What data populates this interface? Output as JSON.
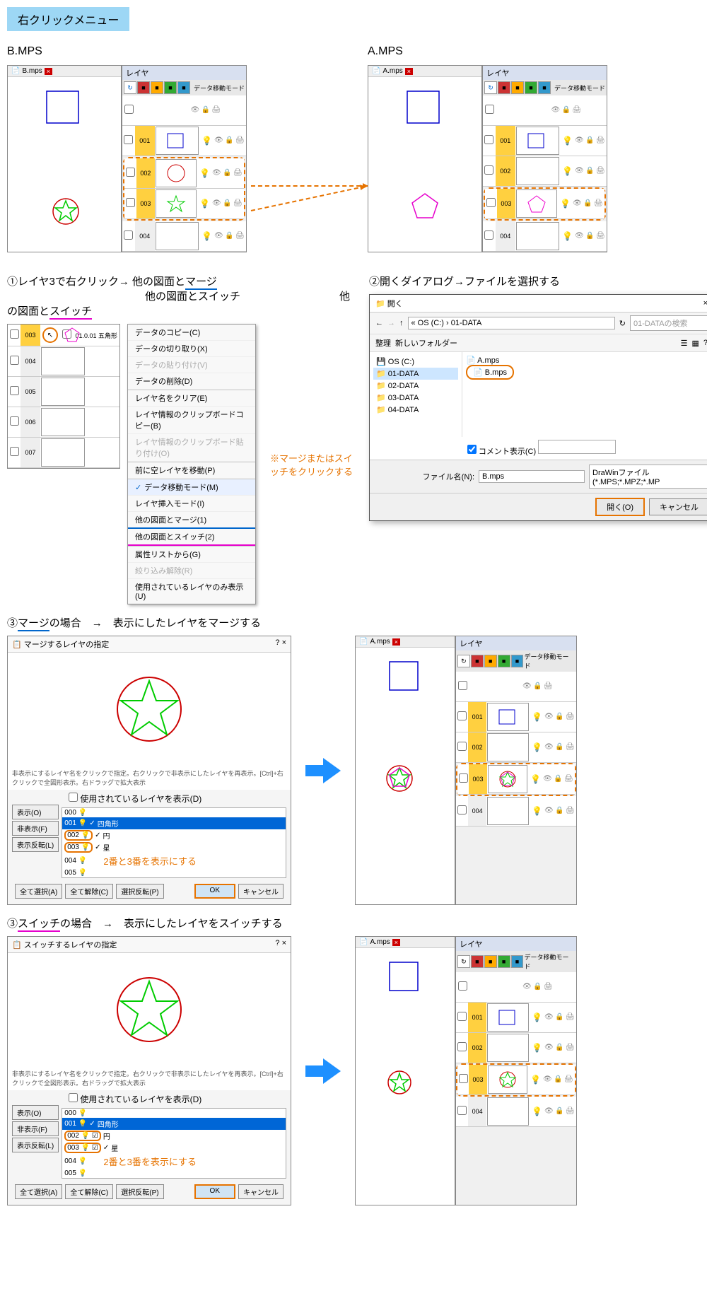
{
  "banner": "右クリックメニュー",
  "tabs": {
    "b": "B.mps",
    "a": "A.mps"
  },
  "labels": {
    "b": "B.MPS",
    "a": "A.MPS",
    "layer": "レイヤ",
    "mode": "データ移動モード"
  },
  "layers": [
    "001",
    "002",
    "003",
    "004",
    "005"
  ],
  "step1": {
    "text": "①レイヤ3で右クリック→ 他の図面と",
    "merge": "マージ",
    "switch": "他の図面とスイッチ",
    "sw": "スイッチ"
  },
  "step2": "②開くダイアログ→ファイルを選択する",
  "ctx": {
    "hdr": "01.0.01  五角形",
    "items": [
      "データのコピー(C)",
      "データの切り取り(X)",
      "データの貼り付け(V)",
      "データの削除(D)",
      "",
      "レイヤ名をクリア(E)",
      "レイヤ情報のクリップボードコピー(B)",
      "レイヤ情報のクリップボード貼り付け(O)",
      "",
      "前に空レイヤを移動(P)",
      "",
      "データ移動モード(M)",
      "レイヤ挿入モード(I)",
      "他の図面とマージ(1)",
      "他の図面とスイッチ(2)",
      "",
      "属性リストから(G)",
      "絞り込み解除(R)",
      "使用されているレイヤのみ表示(U)"
    ]
  },
  "ctxnote": "※マージまたはスイッチをクリックする",
  "open": {
    "title": "開く",
    "path": "« OS (C:) › 01-DATA",
    "search": "01-DATAの検索",
    "org": "整理",
    "newf": "新しいフォルダー",
    "tree": [
      "OS (C:)",
      "01-DATA",
      "02-DATA",
      "03-DATA",
      "04-DATA"
    ],
    "files": [
      "A.mps",
      "B.mps"
    ],
    "comment": "コメント表示(C)",
    "fname": "ファイル名(N):",
    "fval": "B.mps",
    "filter": "DraWinファイル(*.MPS;*.MPZ;*.MP",
    "ok": "開く(O)",
    "cancel": "キャンセル"
  },
  "step3m": "③マージの場合　→　表示にしたレイヤをマージする",
  "step3s": "③スイッチの場合　→　表示にしたレイヤをスイッチする",
  "mdlg": {
    "titlem": "マージするレイヤの指定",
    "titles": "スイッチするレイヤの指定",
    "help": "非表示にするレイヤ名をクリックで指定。右クリックで非表示にしたレイヤを再表示。[Ctrl]+右クリックで全図形表示。右ドラッグで拡大表示",
    "chk": "使用されているレイヤを表示(D)",
    "show": "表示(O)",
    "hide": "非表示(F)",
    "inv": "表示反転(L)",
    "names": [
      "四角形",
      "円",
      "星"
    ],
    "nums": [
      "000",
      "001",
      "002",
      "003",
      "004",
      "005"
    ],
    "note": "2番と3番を表示にする",
    "all": "全て選択(A)",
    "clr": "全て解除(C)",
    "selinv": "選択反転(P)",
    "ok": "OK",
    "cancel": "キャンセル"
  }
}
